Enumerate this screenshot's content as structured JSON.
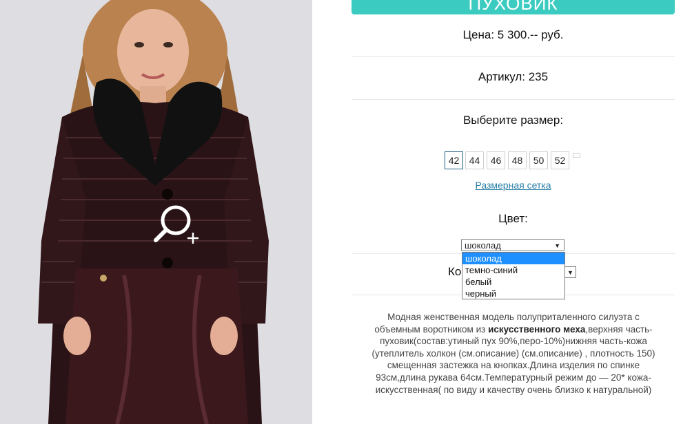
{
  "product": {
    "title": "ПУХОВИК",
    "price": "Цена: 5 300.-- руб.",
    "article": "Артикул: 235"
  },
  "size": {
    "label": "Выберите размер:",
    "options": [
      "42",
      "44",
      "46",
      "48",
      "50",
      "52"
    ],
    "selected": "42",
    "chart_link": "Размерная сетка"
  },
  "color": {
    "label": "Цвет:",
    "selected": "шоколад",
    "options": [
      "шоколад",
      "темно-синий",
      "белый",
      "черный"
    ]
  },
  "quantity": {
    "label": "Ко"
  },
  "description": {
    "part1": "Модная женственная модель полуприталенного силуэта с объемным воротником из ",
    "bold": "искусственного меха",
    "part2": ",верхняя часть-пуховик(состав:утиный пух 90%,перо-10%)нижняя часть-кожа (утеплитель холкон (см.описание) (см.описание) , плотность 150) смещенная застежка на кнопках.Длина изделия по спинке 93см,длина рукава 64см.Температурный режим до — 20* кожа-искусственная( по виду и качеству очень близко к натуральной)"
  },
  "icons": {
    "zoom": "zoom-in-icon",
    "select_arrow": "dropdown-arrow-icon"
  },
  "colors": {
    "banner": "#3ccbc0",
    "link": "#2a7fa8",
    "dropdown_highlight": "#1e90ff"
  }
}
